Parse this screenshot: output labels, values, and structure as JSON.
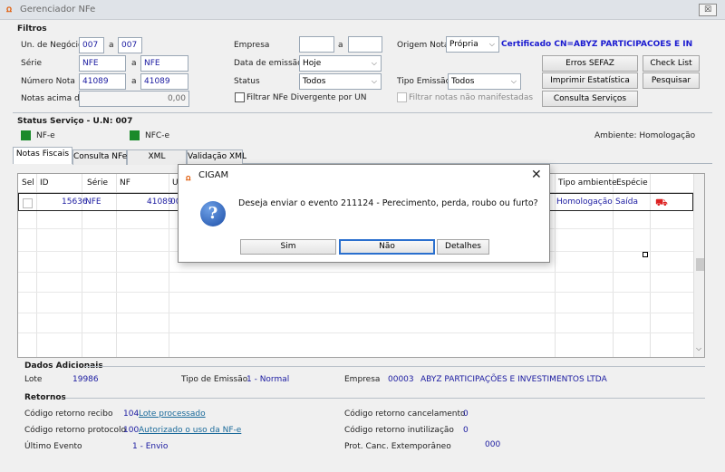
{
  "window": {
    "title": "Gerenciador NFe",
    "close_label": "☒"
  },
  "filtros": {
    "title": "Filtros",
    "un_negocio": {
      "label": "Un. de Negócio",
      "from": "007",
      "a": "a",
      "to": "007"
    },
    "serie": {
      "label": "Série",
      "from": "NFE",
      "a": "a",
      "to": "NFE"
    },
    "numero_nota": {
      "label": "Número Nota",
      "from": "41089",
      "a": "a",
      "to": "41089"
    },
    "notas_acima": {
      "label": "Notas acima de",
      "value": "0,00"
    },
    "empresa": {
      "label": "Empresa",
      "from": "",
      "a": "a",
      "to": ""
    },
    "data_emissao": {
      "label": "Data de emissão",
      "value": "Hoje"
    },
    "status": {
      "label": "Status",
      "value": "Todos"
    },
    "filtrar_divergente": {
      "label": "Filtrar NFe Divergente por UN"
    },
    "origem_nota": {
      "label": "Origem Nota",
      "value": "Própria"
    },
    "certificado": "Certificado CN=ABYZ PARTICIPACOES E INVEST",
    "tipo_emissao": {
      "label": "Tipo Emissão",
      "value": "Todos"
    },
    "filtrar_nao_manifestadas": {
      "label": "Filtrar notas não manifestadas"
    },
    "buttons": {
      "erros_sefaz": "Erros SEFAZ",
      "check_list": "Check List",
      "imprimir_estatistica": "Imprimir Estatística",
      "pesquisar": "Pesquisar",
      "consulta_servicos": "Consulta Serviços"
    }
  },
  "status_servico": {
    "title": "Status Serviço - U.N: 007",
    "nfe": "NF-e",
    "nfce": "NFC-e",
    "ambiente": "Ambiente: Homologação",
    "status_color": "#1a8a2a"
  },
  "tabs": [
    "Notas Fiscais",
    "Consulta NFe",
    "XML",
    "Validação XML"
  ],
  "grid": {
    "headers": [
      "Sel",
      "ID",
      "Série",
      "NF",
      "U",
      "Tipo ambiente",
      "Espécie"
    ],
    "row": {
      "id": "15636",
      "serie": "NFE",
      "nf": "41089",
      "u": "00",
      "tipo_ambiente": "Homologação",
      "especie": "Saída"
    }
  },
  "dialog": {
    "title": "CIGAM",
    "message": "Deseja enviar o evento 211124 - Perecimento, perda, roubo ou furto?",
    "buttons": {
      "sim": "Sim",
      "nao": "Não",
      "detalhes": "Detalhes"
    }
  },
  "dados_adicionais": {
    "title": "Dados Adicionais",
    "lote_label": "Lote",
    "lote_value": "19986",
    "tipo_emissao_label": "Tipo de Emissão",
    "tipo_emissao_value": "1 - Normal",
    "empresa_label": "Empresa",
    "empresa_code": "00003",
    "empresa_name": "ABYZ PARTICIPAÇÕES E INVESTIMENTOS LTDA"
  },
  "retornos": {
    "title": "Retornos",
    "recibo_label": "Código retorno recibo",
    "recibo_code": "104",
    "recibo_text": "Lote processado",
    "protocolo_label": "Código retorno protocolo",
    "protocolo_code": "100",
    "protocolo_text": "Autorizado o uso da NF-e",
    "ultimo_evento_label": "Último Evento",
    "ultimo_evento_value": "1 - Envio",
    "cancelamento_label": "Código retorno cancelamento",
    "cancelamento_value": "0",
    "inutilizacao_label": "Código retorno inutilização",
    "inutilizacao_value": "0",
    "prot_canc_label": "Prot. Canc. Extemporâneo",
    "prot_canc_value": "000"
  }
}
